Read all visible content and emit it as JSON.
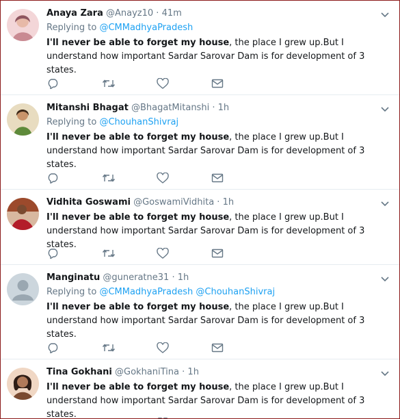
{
  "tweets": [
    {
      "name": "Anaya Zara",
      "handle": "@Anayz10",
      "dot": "·",
      "time": "41m",
      "replying_prefix": "Replying to",
      "replying_to": [
        "@CMMadhyaPradesh"
      ],
      "text_bold": "I'll never be able to forget my house",
      "text_rest": ", the place I grew up.But I understand how important Sardar Sarovar Dam is for development of 3 states.",
      "avatar_colors": [
        "#f3d6d8",
        "#c98a92",
        "#8e5560"
      ]
    },
    {
      "name": "Mitanshi Bhagat",
      "handle": "@BhagatMitanshi",
      "dot": "·",
      "time": "1h",
      "replying_prefix": "Replying to",
      "replying_to": [
        "@ChouhanShivraj"
      ],
      "text_bold": "I'll never be able to forget my house",
      "text_rest": ", the place I grew up.But I understand how important Sardar Sarovar Dam is for development of 3 states.",
      "avatar_colors": [
        "#e8dcc0",
        "#b88c4e",
        "#5e8a3a"
      ]
    },
    {
      "name": "Vidhita Goswami",
      "handle": "@GoswamiVidhita",
      "dot": "·",
      "time": "1h",
      "replying_prefix": "",
      "replying_to": [],
      "text_bold": "I'll never be able to forget my house",
      "text_rest": ", the place I grew up.But I understand how important Sardar Sarovar Dam is for development of 3 states.",
      "avatar_colors": [
        "#d8b8a0",
        "#9c4a2c",
        "#b31d2a"
      ]
    },
    {
      "name": "Manginatu",
      "handle": "@guneratne31",
      "dot": "·",
      "time": "1h",
      "replying_prefix": "Replying to",
      "replying_to": [
        "@CMMadhyaPradesh",
        "@ChouhanShivraj"
      ],
      "text_bold": "I'll never be able to forget my house",
      "text_rest": ", the place I grew up.But I understand how important Sardar Sarovar Dam is for development of 3 states.",
      "avatar_colors": [
        "#ccd6dd",
        "#9aa7b1",
        "#e1e8ed"
      ]
    },
    {
      "name": "Tina Gokhani",
      "handle": "@GokhaniTina",
      "dot": "·",
      "time": "1h",
      "replying_prefix": "",
      "replying_to": [],
      "text_bold": "I'll never be able to forget my house",
      "text_rest": ", the place I grew up.But I understand how important Sardar Sarovar Dam is for development of 3 states.",
      "avatar_colors": [
        "#f0d7c4",
        "#7a4a30",
        "#2e1d16"
      ]
    }
  ],
  "icons": {
    "reply": "reply-icon",
    "retweet": "retweet-icon",
    "like": "heart-icon",
    "dm": "envelope-icon",
    "caret": "chevron-down-icon"
  },
  "colors": {
    "link": "#1da1f2",
    "secondary": "#657786",
    "text": "#14171a",
    "icon": "#657786",
    "divider": "#e6ecf0",
    "frame": "#8b1a1a"
  }
}
